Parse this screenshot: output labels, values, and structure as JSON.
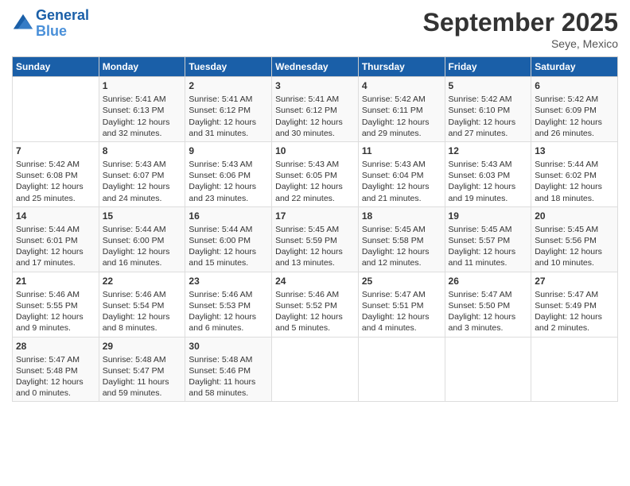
{
  "header": {
    "logo_line1": "General",
    "logo_line2": "Blue",
    "month": "September 2025",
    "location": "Seye, Mexico"
  },
  "days_of_week": [
    "Sunday",
    "Monday",
    "Tuesday",
    "Wednesday",
    "Thursday",
    "Friday",
    "Saturday"
  ],
  "weeks": [
    [
      {
        "day": "",
        "info": ""
      },
      {
        "day": "1",
        "info": "Sunrise: 5:41 AM\nSunset: 6:13 PM\nDaylight: 12 hours\nand 32 minutes."
      },
      {
        "day": "2",
        "info": "Sunrise: 5:41 AM\nSunset: 6:12 PM\nDaylight: 12 hours\nand 31 minutes."
      },
      {
        "day": "3",
        "info": "Sunrise: 5:41 AM\nSunset: 6:12 PM\nDaylight: 12 hours\nand 30 minutes."
      },
      {
        "day": "4",
        "info": "Sunrise: 5:42 AM\nSunset: 6:11 PM\nDaylight: 12 hours\nand 29 minutes."
      },
      {
        "day": "5",
        "info": "Sunrise: 5:42 AM\nSunset: 6:10 PM\nDaylight: 12 hours\nand 27 minutes."
      },
      {
        "day": "6",
        "info": "Sunrise: 5:42 AM\nSunset: 6:09 PM\nDaylight: 12 hours\nand 26 minutes."
      }
    ],
    [
      {
        "day": "7",
        "info": "Sunrise: 5:42 AM\nSunset: 6:08 PM\nDaylight: 12 hours\nand 25 minutes."
      },
      {
        "day": "8",
        "info": "Sunrise: 5:43 AM\nSunset: 6:07 PM\nDaylight: 12 hours\nand 24 minutes."
      },
      {
        "day": "9",
        "info": "Sunrise: 5:43 AM\nSunset: 6:06 PM\nDaylight: 12 hours\nand 23 minutes."
      },
      {
        "day": "10",
        "info": "Sunrise: 5:43 AM\nSunset: 6:05 PM\nDaylight: 12 hours\nand 22 minutes."
      },
      {
        "day": "11",
        "info": "Sunrise: 5:43 AM\nSunset: 6:04 PM\nDaylight: 12 hours\nand 21 minutes."
      },
      {
        "day": "12",
        "info": "Sunrise: 5:43 AM\nSunset: 6:03 PM\nDaylight: 12 hours\nand 19 minutes."
      },
      {
        "day": "13",
        "info": "Sunrise: 5:44 AM\nSunset: 6:02 PM\nDaylight: 12 hours\nand 18 minutes."
      }
    ],
    [
      {
        "day": "14",
        "info": "Sunrise: 5:44 AM\nSunset: 6:01 PM\nDaylight: 12 hours\nand 17 minutes."
      },
      {
        "day": "15",
        "info": "Sunrise: 5:44 AM\nSunset: 6:00 PM\nDaylight: 12 hours\nand 16 minutes."
      },
      {
        "day": "16",
        "info": "Sunrise: 5:44 AM\nSunset: 6:00 PM\nDaylight: 12 hours\nand 15 minutes."
      },
      {
        "day": "17",
        "info": "Sunrise: 5:45 AM\nSunset: 5:59 PM\nDaylight: 12 hours\nand 13 minutes."
      },
      {
        "day": "18",
        "info": "Sunrise: 5:45 AM\nSunset: 5:58 PM\nDaylight: 12 hours\nand 12 minutes."
      },
      {
        "day": "19",
        "info": "Sunrise: 5:45 AM\nSunset: 5:57 PM\nDaylight: 12 hours\nand 11 minutes."
      },
      {
        "day": "20",
        "info": "Sunrise: 5:45 AM\nSunset: 5:56 PM\nDaylight: 12 hours\nand 10 minutes."
      }
    ],
    [
      {
        "day": "21",
        "info": "Sunrise: 5:46 AM\nSunset: 5:55 PM\nDaylight: 12 hours\nand 9 minutes."
      },
      {
        "day": "22",
        "info": "Sunrise: 5:46 AM\nSunset: 5:54 PM\nDaylight: 12 hours\nand 8 minutes."
      },
      {
        "day": "23",
        "info": "Sunrise: 5:46 AM\nSunset: 5:53 PM\nDaylight: 12 hours\nand 6 minutes."
      },
      {
        "day": "24",
        "info": "Sunrise: 5:46 AM\nSunset: 5:52 PM\nDaylight: 12 hours\nand 5 minutes."
      },
      {
        "day": "25",
        "info": "Sunrise: 5:47 AM\nSunset: 5:51 PM\nDaylight: 12 hours\nand 4 minutes."
      },
      {
        "day": "26",
        "info": "Sunrise: 5:47 AM\nSunset: 5:50 PM\nDaylight: 12 hours\nand 3 minutes."
      },
      {
        "day": "27",
        "info": "Sunrise: 5:47 AM\nSunset: 5:49 PM\nDaylight: 12 hours\nand 2 minutes."
      }
    ],
    [
      {
        "day": "28",
        "info": "Sunrise: 5:47 AM\nSunset: 5:48 PM\nDaylight: 12 hours\nand 0 minutes."
      },
      {
        "day": "29",
        "info": "Sunrise: 5:48 AM\nSunset: 5:47 PM\nDaylight: 11 hours\nand 59 minutes."
      },
      {
        "day": "30",
        "info": "Sunrise: 5:48 AM\nSunset: 5:46 PM\nDaylight: 11 hours\nand 58 minutes."
      },
      {
        "day": "",
        "info": ""
      },
      {
        "day": "",
        "info": ""
      },
      {
        "day": "",
        "info": ""
      },
      {
        "day": "",
        "info": ""
      }
    ]
  ]
}
